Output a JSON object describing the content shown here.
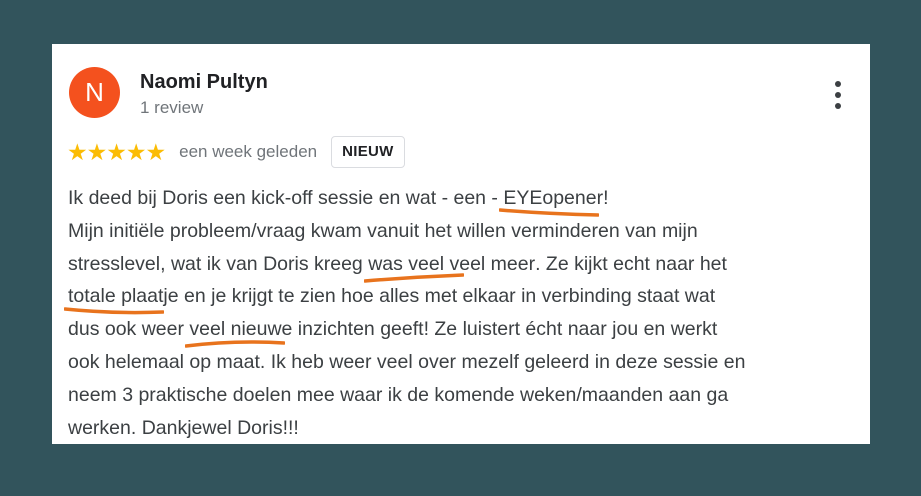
{
  "reviewer": {
    "initial": "N",
    "name": "Naomi Pultyn",
    "review_count": "1 review",
    "avatar_color": "#f4511e"
  },
  "review": {
    "rating": 5,
    "stars": "★★★★★",
    "date": "een week geleden",
    "badge": "NIEUW",
    "lines": [
      [
        "Ik deed bij Doris een kick-off sessie en wat - een - ",
        "EYEopener",
        "!"
      ],
      [
        "Mijn initiële probleem/vraag kwam vanuit het willen verminderen van mijn"
      ],
      [
        "stresslevel, wat ik van Doris kreeg ",
        "was veel veel meer",
        ". Ze kijkt echt naar het"
      ],
      [
        "totale plaat",
        "je en je krijgt te zien hoe alles met elkaar in verbinding staat wat"
      ],
      [
        "dus ook weer ",
        "veel nieuwe inzichten geeft",
        "! Ze luistert écht naar jou en werkt"
      ],
      [
        "ook helemaal op maat. Ik heb weer veel over mezelf geleerd in deze sessie en"
      ],
      [
        "neem 3 praktische doelen mee waar ik de komende weken/maanden aan ga"
      ],
      [
        "werken. Dankjewel Doris!!!"
      ]
    ]
  },
  "colors": {
    "background": "#32545c",
    "star": "#fbbc04",
    "annotation": "#e8731d"
  },
  "icons": {
    "more": "more-vert-icon",
    "stars": "star-icon"
  }
}
